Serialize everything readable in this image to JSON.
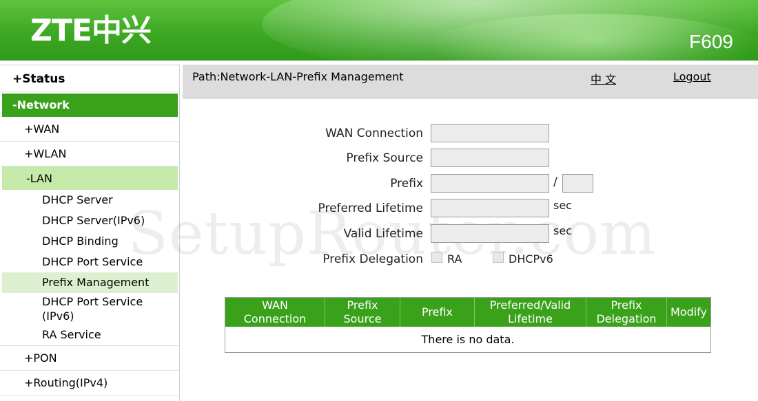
{
  "header": {
    "logo_text": "ZTE中兴",
    "model": "F609",
    "background_color": "#3da823"
  },
  "sidebar": {
    "status": "+Status",
    "network": "-Network",
    "wan": "+WAN",
    "wlan": "+WLAN",
    "lan": "-LAN",
    "lan_items": [
      "DHCP Server",
      "DHCP Server(IPv6)",
      "DHCP Binding",
      "DHCP Port Service",
      "Prefix Management"
    ],
    "dhcp_port_service_ipv6_line1": "DHCP Port Service",
    "dhcp_port_service_ipv6_line2": "(IPv6)",
    "ra_service": "RA Service",
    "pon": "+PON",
    "routing": "+Routing(IPv4)"
  },
  "topbar": {
    "path": "Path:Network-LAN-Prefix Management",
    "language": "中 文",
    "logout": "Logout"
  },
  "form": {
    "wan_connection_label": "WAN Connection",
    "wan_connection_value": "",
    "prefix_source_label": "Prefix Source",
    "prefix_source_value": "",
    "prefix_label": "Prefix",
    "prefix_value": "",
    "prefix_slash": "/",
    "prefix_length_value": "",
    "preferred_lifetime_label": "Preferred Lifetime",
    "preferred_lifetime_value": "",
    "valid_lifetime_label": "Valid Lifetime",
    "valid_lifetime_value": "",
    "sec_unit": "sec",
    "prefix_delegation_label": "Prefix Delegation",
    "ra_label": "RA",
    "dhcpv6_label": "DHCPv6"
  },
  "watermark": "SetupRouter.com",
  "table": {
    "headers": [
      [
        "WAN",
        "Connection"
      ],
      [
        "Prefix",
        "Source"
      ],
      [
        "Prefix"
      ],
      [
        "Preferred/Valid",
        "Lifetime"
      ],
      [
        "Prefix",
        "Delegation"
      ],
      [
        "Modify"
      ]
    ],
    "empty_message": "There is no data."
  }
}
